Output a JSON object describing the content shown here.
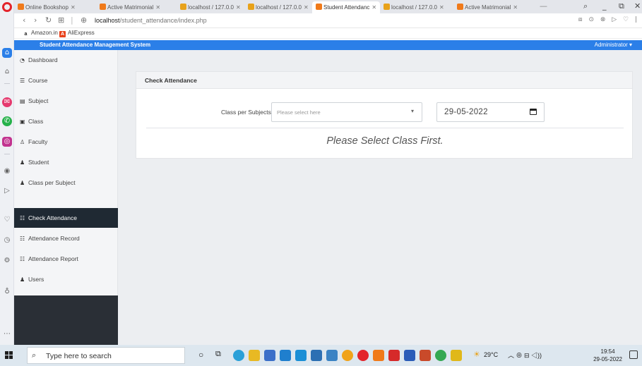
{
  "browser": {
    "tabs": [
      {
        "label": "Online Bookshop",
        "favicon": "orange-square"
      },
      {
        "label": "Active Matrimonial",
        "favicon": "orange-square"
      },
      {
        "label": "localhost / 127.0.0",
        "favicon": "phpmyadmin-sail"
      },
      {
        "label": "localhost / 127.0.0",
        "favicon": "phpmyadmin-sail"
      },
      {
        "label": "Student Attendanc",
        "favicon": "orange-square",
        "active": true
      },
      {
        "label": "localhost / 127.0.0",
        "favicon": "phpmyadmin-sail"
      },
      {
        "label": "Active Matrimonial",
        "favicon": "orange-square"
      }
    ],
    "url_host": "localhost",
    "url_path": "/student_attendance/index.php",
    "bookmarks": [
      {
        "label": "Amazon.in",
        "icon": "amazon-icon"
      },
      {
        "label": "AliExpress",
        "icon": "aliexpress-icon"
      }
    ]
  },
  "app": {
    "title": "Student Attendance Management System",
    "user_menu": "Administrator ▾"
  },
  "sidebar": {
    "items": [
      {
        "label": "Dashboard",
        "icon": "tachometer-icon"
      },
      {
        "label": "Course",
        "icon": "list-icon"
      },
      {
        "label": "Subject",
        "icon": "book-icon"
      },
      {
        "label": "Class",
        "icon": "square-icon"
      },
      {
        "label": "Faculty",
        "icon": "user-icon"
      },
      {
        "label": "Student",
        "icon": "users-icon"
      },
      {
        "label": "Class per Subject",
        "icon": "users-icon"
      },
      {
        "label": "Check Attendance",
        "icon": "checklist-icon",
        "active": true
      },
      {
        "label": "Attendance Record",
        "icon": "checklist-icon"
      },
      {
        "label": "Attendance Report",
        "icon": "checklist-icon"
      },
      {
        "label": "Users",
        "icon": "users-cog-icon"
      }
    ]
  },
  "main": {
    "card_title": "Check Attendance",
    "class_label": "Class per Subjects",
    "class_placeholder": "Please select here",
    "date_value": "29-05-2022",
    "empty_message": "Please Select Class First."
  },
  "taskbar": {
    "search_placeholder": "Type here to search",
    "weather": "29°C",
    "time": "19:54",
    "date": "29-05-2022"
  },
  "colors": {
    "accent": "#2b7fe8",
    "active_menu": "#1f2933",
    "sidebar_bg": "#f4f5f7",
    "content_bg": "#eceef1"
  }
}
